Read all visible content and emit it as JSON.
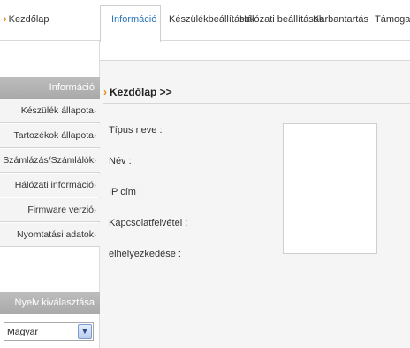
{
  "nav": {
    "home_label": "Kezdőlap",
    "tabs": [
      {
        "label": "Információ"
      },
      {
        "label": "Készülékbeállítások"
      },
      {
        "label": "Hálózati beállítások"
      },
      {
        "label": "Karbantartás"
      },
      {
        "label": "Támogatás"
      }
    ]
  },
  "sidebar": {
    "info_header": "Információ",
    "items": [
      {
        "label": "Készülék állapota"
      },
      {
        "label": "Tartozékok állapota"
      },
      {
        "label": "Számlázás/Számlálók"
      },
      {
        "label": "Hálózati információ"
      },
      {
        "label": "Firmware verzió"
      },
      {
        "label": "Nyomtatási adatok"
      }
    ],
    "lang_header": "Nyelv kiválasztása",
    "lang_value": "Magyar"
  },
  "main": {
    "breadcrumb": "Kezdőlap >>",
    "fields": [
      {
        "label": "Típus neve :"
      },
      {
        "label": "Név :"
      },
      {
        "label": "IP cím :"
      },
      {
        "label": "Kapcsolatfelvétel :"
      },
      {
        "label": "elhelyezkedése :"
      }
    ]
  },
  "colors": {
    "accent_orange": "#e8860c",
    "active_tab_blue": "#2b74b8",
    "sidebar_header_gray": "#b3b3b3"
  }
}
